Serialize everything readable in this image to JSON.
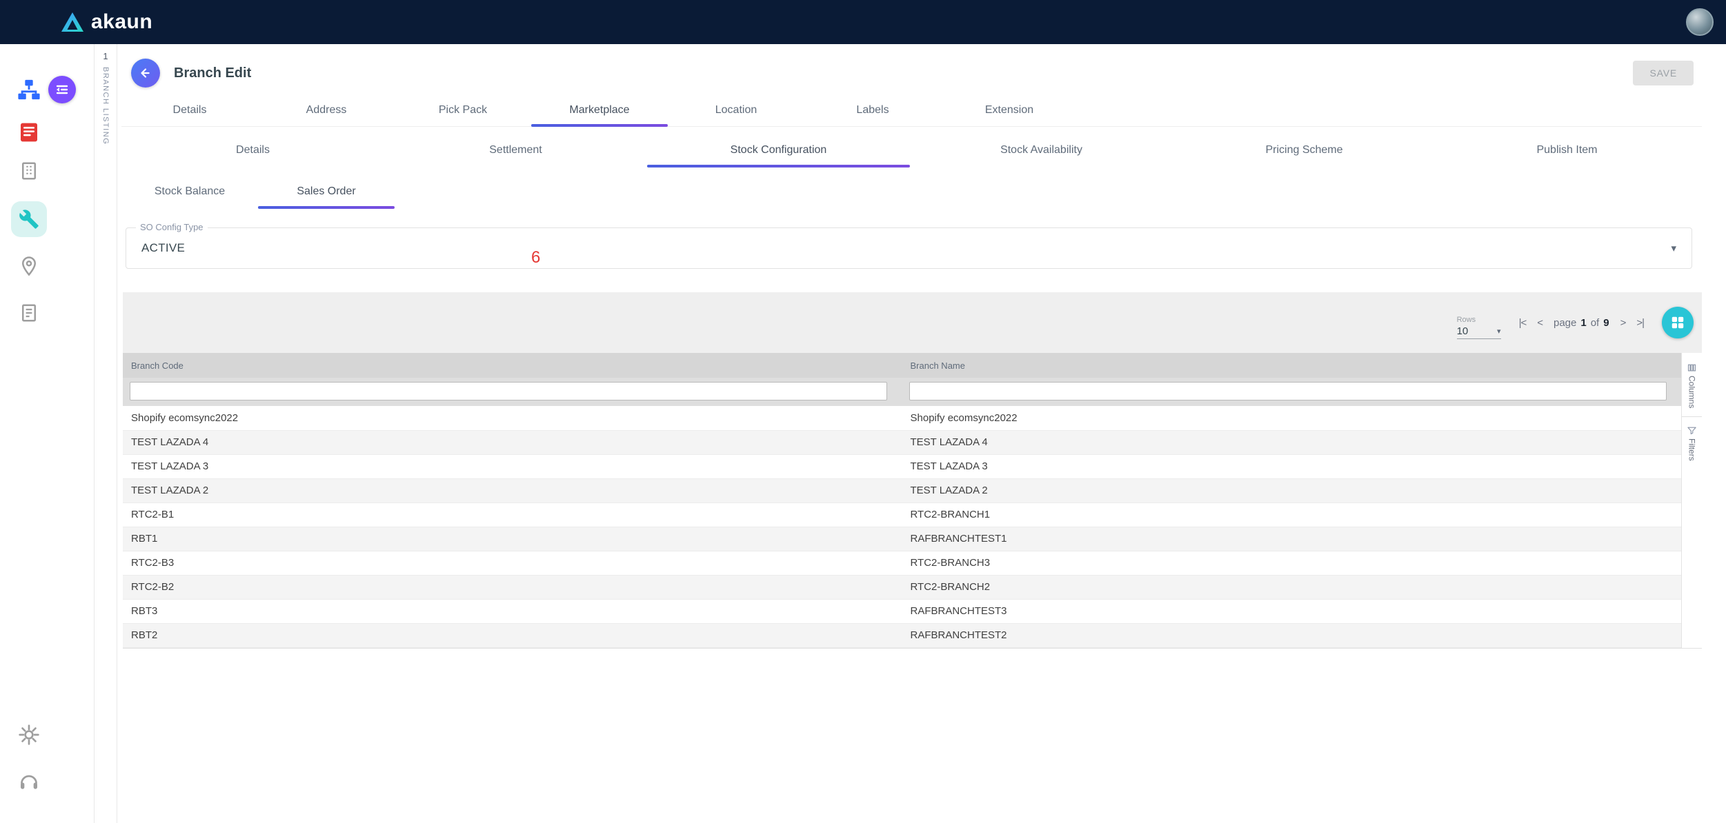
{
  "topbar": {
    "brand": "akaun"
  },
  "sidebar": {
    "applets": [
      "org-chart",
      "red-ledger",
      "building",
      "tools",
      "location-pin",
      "document"
    ],
    "bottom": [
      "settings-gear",
      "support-headset"
    ],
    "active_applet": "tools"
  },
  "rail": {
    "index": "1",
    "label": "BRANCH LISTING"
  },
  "header": {
    "title": "Branch Edit",
    "save_label": "SAVE"
  },
  "tabs_level1": {
    "items": [
      "Details",
      "Address",
      "Pick Pack",
      "Marketplace",
      "Location",
      "Labels",
      "Extension"
    ],
    "active": "Marketplace"
  },
  "tabs_level2": {
    "items": [
      "Details",
      "Settlement",
      "Stock Configuration",
      "Stock Availability",
      "Pricing Scheme",
      "Publish Item"
    ],
    "active": "Stock Configuration"
  },
  "tabs_level3": {
    "items": [
      "Stock Balance",
      "Sales Order"
    ],
    "active": "Sales Order"
  },
  "form": {
    "so_config_label": "SO Config Type",
    "so_config_value": "ACTIVE"
  },
  "annotation": {
    "text": "6",
    "color": "#e53935"
  },
  "toolbar": {
    "rows_label": "Rows",
    "rows_value": "10",
    "page_label": "page",
    "page_current": "1",
    "of_label": "of",
    "page_total": "9"
  },
  "icons": {
    "first_page": "|<",
    "prev_page": "<",
    "next_page": ">",
    "last_page": ">|",
    "caret_down": "▾"
  },
  "table": {
    "columns": [
      "Branch Code",
      "Branch Name"
    ],
    "filters": [
      "",
      ""
    ],
    "rows": [
      [
        "Shopify ecomsync2022",
        "Shopify ecomsync2022"
      ],
      [
        "TEST LAZADA 4",
        "TEST LAZADA 4"
      ],
      [
        "TEST LAZADA 3",
        "TEST LAZADA 3"
      ],
      [
        "TEST LAZADA 2",
        "TEST LAZADA 2"
      ],
      [
        "RTC2-B1",
        "RTC2-BRANCH1"
      ],
      [
        "RBT1",
        "RAFBRANCHTEST1"
      ],
      [
        "RTC2-B3",
        "RTC2-BRANCH3"
      ],
      [
        "RTC2-B2",
        "RTC2-BRANCH2"
      ],
      [
        "RBT3",
        "RAFBRANCHTEST3"
      ],
      [
        "RBT2",
        "RAFBRANCHTEST2"
      ]
    ]
  },
  "right_rail": {
    "columns_label": "Columns",
    "filters_label": "Filters"
  },
  "colors": {
    "topbar_bg": "#0a1b36",
    "accent_purple": "#7c4dff",
    "tab_underline_start": "#4a5fe0",
    "tab_underline_end": "#7b4ce0",
    "teal_button": "#29c5d6",
    "annotation_red": "#e53935"
  }
}
